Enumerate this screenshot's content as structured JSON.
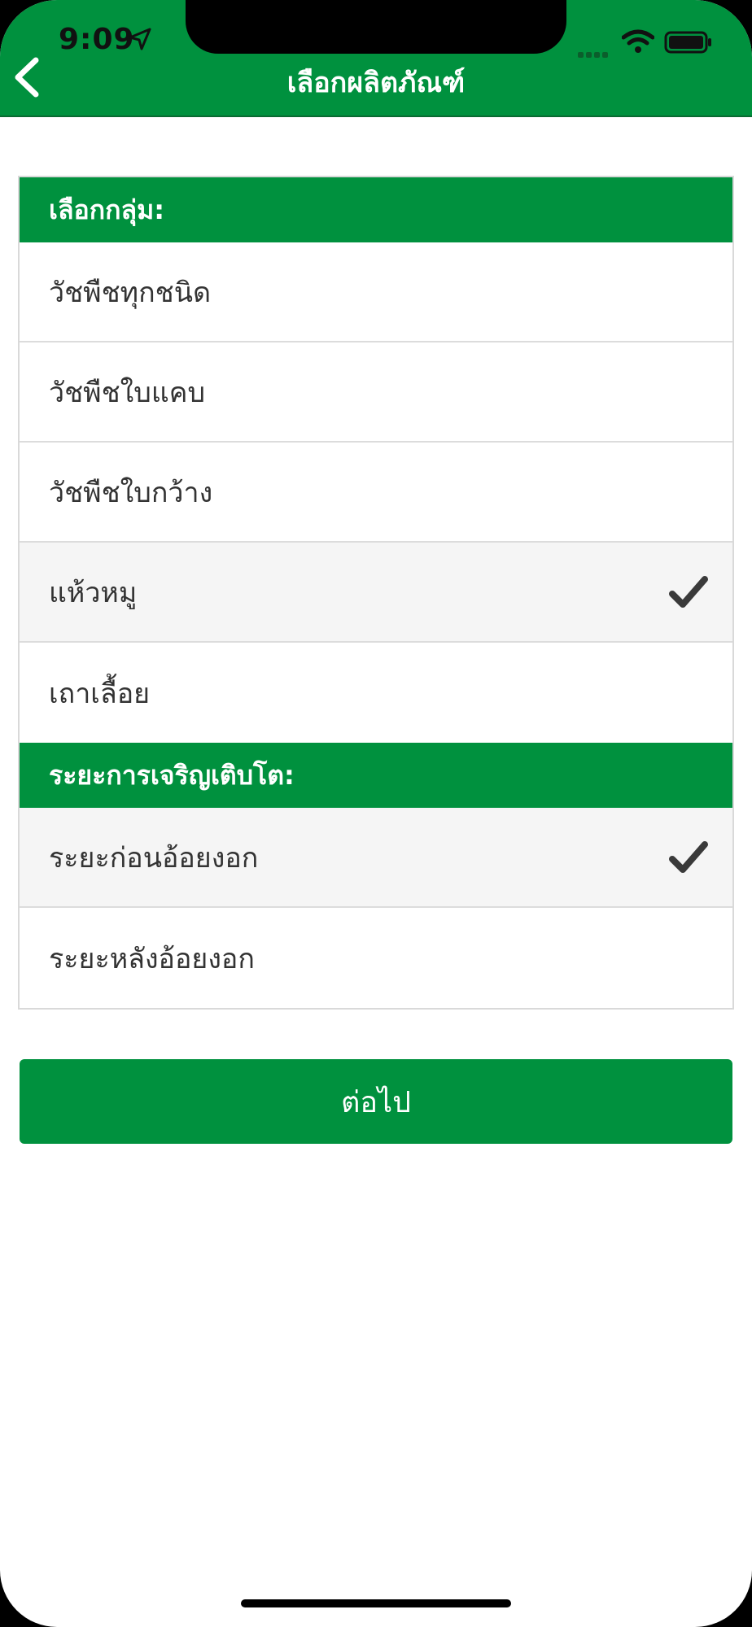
{
  "status_bar": {
    "time": "9:09"
  },
  "header": {
    "title": "เลือกผลิตภัณฑ์"
  },
  "groups": {
    "header": "เลือกกลุ่ม:",
    "options": [
      {
        "label": "วัชพืชทุกชนิด",
        "selected": false
      },
      {
        "label": "วัชพืชใบแคบ",
        "selected": false
      },
      {
        "label": "วัชพืชใบกว้าง",
        "selected": false
      },
      {
        "label": "แห้วหมู",
        "selected": true
      },
      {
        "label": "เถาเลื้อย",
        "selected": false
      }
    ]
  },
  "growth_stage": {
    "header": "ระยะการเจริญเติบโต:",
    "options": [
      {
        "label": "ระยะก่อนอ้อยงอก",
        "selected": true
      },
      {
        "label": "ระยะหลังอ้อยงอก",
        "selected": false
      }
    ]
  },
  "actions": {
    "next_label": "ต่อไป"
  },
  "colors": {
    "brand_green": "#00913e",
    "selected_row": "#f5f5f5",
    "check": "#3a3a3a"
  },
  "icons": {
    "back": "chevron-left-icon",
    "check": "checkmark-icon"
  }
}
